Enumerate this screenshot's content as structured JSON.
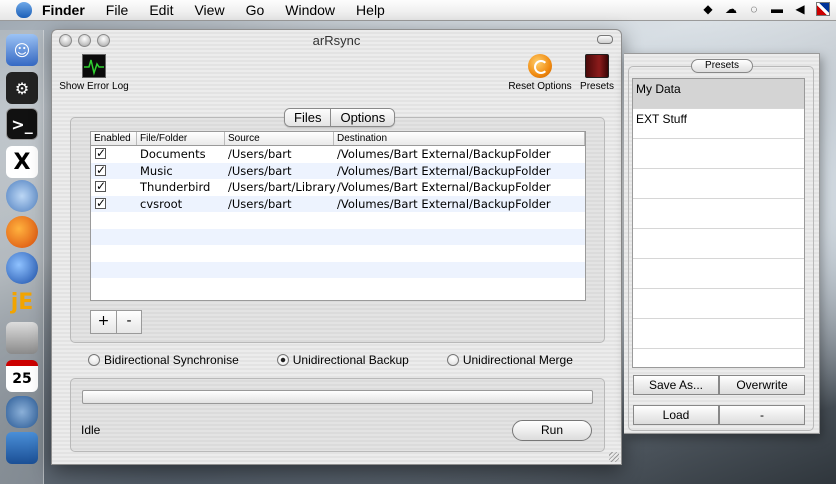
{
  "menubar": {
    "items": [
      "Finder",
      "File",
      "Edit",
      "View",
      "Go",
      "Window",
      "Help"
    ]
  },
  "window": {
    "title": "arRsync",
    "toolbar": {
      "show_error_log": "Show Error Log",
      "reset_options": "Reset Options",
      "presets": "Presets"
    },
    "tabs": [
      "Files",
      "Options"
    ],
    "table": {
      "headers": [
        "Enabled",
        "File/Folder",
        "Source",
        "Destination"
      ],
      "rows": [
        {
          "checked": "✓",
          "name": "Documents",
          "source": "/Users/bart",
          "destination": "/Volumes/Bart External/BackupFolder"
        },
        {
          "checked": "✓",
          "name": "Music",
          "source": "/Users/bart",
          "destination": "/Volumes/Bart External/BackupFolder"
        },
        {
          "checked": "✓",
          "name": "Thunderbird",
          "source": "/Users/bart/Library",
          "destination": "/Volumes/Bart External/BackupFolder"
        },
        {
          "checked": "✓",
          "name": "cvsroot",
          "source": "/Users/bart",
          "destination": "/Volumes/Bart External/BackupFolder"
        }
      ]
    },
    "add_label": "+",
    "remove_label": "-",
    "modes": {
      "bidirectional": "Bidirectional Synchronise",
      "unidirectional_backup": "Unidirectional Backup",
      "unidirectional_merge": "Unidirectional Merge",
      "selected": "Unidirectional Backup"
    },
    "progress": 0,
    "status": "Idle",
    "run_label": "Run"
  },
  "drawer": {
    "title": "Presets",
    "items": [
      "My Data",
      "EXT Stuff"
    ],
    "selected": "My Data",
    "save_as": "Save As...",
    "overwrite": "Overwrite",
    "load": "Load",
    "delete": "-"
  },
  "colors": {
    "selection": "#d4d4d4",
    "row_stripe": "#edf3fe",
    "accent_orange": "#f08a10"
  }
}
